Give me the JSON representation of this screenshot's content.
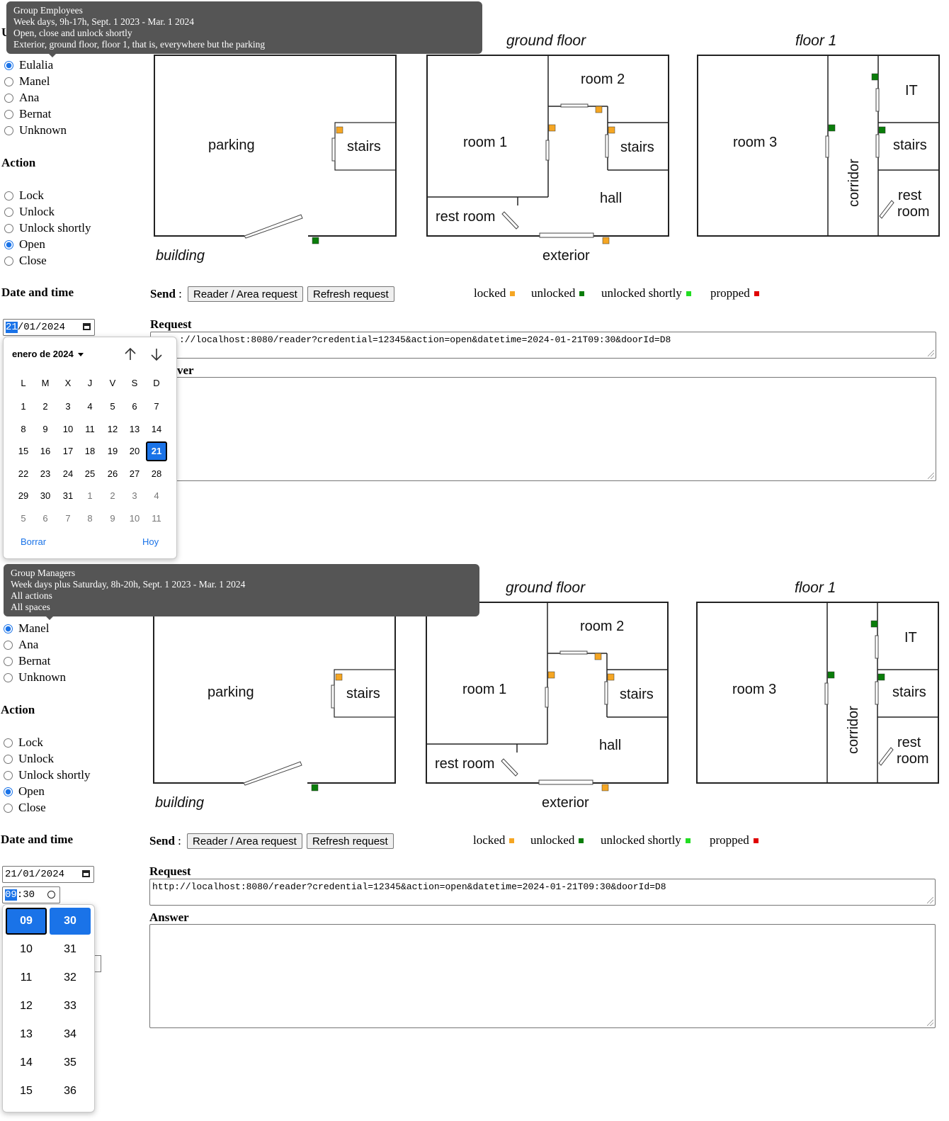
{
  "panels": [
    {
      "tooltip": [
        "Group Employees",
        "Week days, 9h-17h, Sept. 1 2023 - Mar. 1 2024",
        "Open, close and unlock shortly",
        "Exterior, ground floor, floor 1, that is, everywhere but the parking"
      ],
      "users": [
        "Eulalia",
        "Manel",
        "Ana",
        "Bernat",
        "Unknown"
      ],
      "selected_user": "Eulalia",
      "date_value": {
        "day": "21",
        "rest": "/01/2024"
      },
      "request": "http://localhost:8080/reader?credential=12345&action=open&datetime=2024-01-21T09:30&doorId=D8",
      "request_visible": "://localhost:8080/reader?credential=12345&action=open&datetime=2024-01-21T09:30&doorId=D8",
      "answer_label_visible": "ver"
    },
    {
      "tooltip": [
        "Group Managers",
        "Week days plus Saturday, 8h-20h, Sept. 1 2023 - Mar. 1 2024",
        "All actions",
        "All spaces"
      ],
      "users": [
        "Manel",
        "Ana",
        "Bernat",
        "Unknown"
      ],
      "selected_user": "Manel",
      "date_value": {
        "full": "21/01/2024"
      },
      "time_value": {
        "hour": "09",
        "rest": ":30"
      },
      "request": "http://localhost:8080/reader?credential=12345&action=open&datetime=2024-01-21T09:30&doorId=D8",
      "answer_label": "Answer"
    }
  ],
  "action": {
    "label": "Action",
    "options": [
      "Lock",
      "Unlock",
      "Unlock shortly",
      "Open",
      "Close"
    ],
    "selected": "Open"
  },
  "datetime_label": "Date and time",
  "send": {
    "label": "Send",
    "sep": ":",
    "reader_button": "Reader / Area request",
    "refresh_button": "Refresh request"
  },
  "legend": [
    {
      "label": "locked",
      "color": "#f5a623"
    },
    {
      "label": "unlocked",
      "color": "#0a7d0a"
    },
    {
      "label": "unlocked shortly",
      "color": "#22dd22"
    },
    {
      "label": "propped",
      "color": "#e00000"
    }
  ],
  "request_label": "Request",
  "maps": {
    "ground_floor_title": "ground floor",
    "floor1_title": "floor 1",
    "parking": "parking",
    "stairs": "stairs",
    "building": "building",
    "room1": "room 1",
    "room2": "room 2",
    "hall": "hall",
    "rest_room": "rest room",
    "exterior": "exterior",
    "room3": "room 3",
    "it": "IT",
    "corridor": "corridor",
    "rest": "rest",
    "room": "room"
  },
  "calendar": {
    "month": "enero de 2024",
    "dropdown_icon": "caret-down-icon",
    "weekdays": [
      "L",
      "M",
      "X",
      "J",
      "V",
      "S",
      "D"
    ],
    "weeks": [
      [
        "1",
        "2",
        "3",
        "4",
        "5",
        "6",
        "7"
      ],
      [
        "8",
        "9",
        "10",
        "11",
        "12",
        "13",
        "14"
      ],
      [
        "15",
        "16",
        "17",
        "18",
        "19",
        "20",
        "21"
      ],
      [
        "22",
        "23",
        "24",
        "25",
        "26",
        "27",
        "28"
      ],
      [
        "29",
        "30",
        "31",
        "1",
        "2",
        "3",
        "4"
      ],
      [
        "5",
        "6",
        "7",
        "8",
        "9",
        "10",
        "11"
      ]
    ],
    "selected": "21",
    "clear": "Borrar",
    "today": "Hoy"
  },
  "timepicker": {
    "hours": [
      "09",
      "10",
      "11",
      "12",
      "13",
      "14",
      "15"
    ],
    "minutes": [
      "30",
      "31",
      "32",
      "33",
      "34",
      "35",
      "36"
    ]
  }
}
